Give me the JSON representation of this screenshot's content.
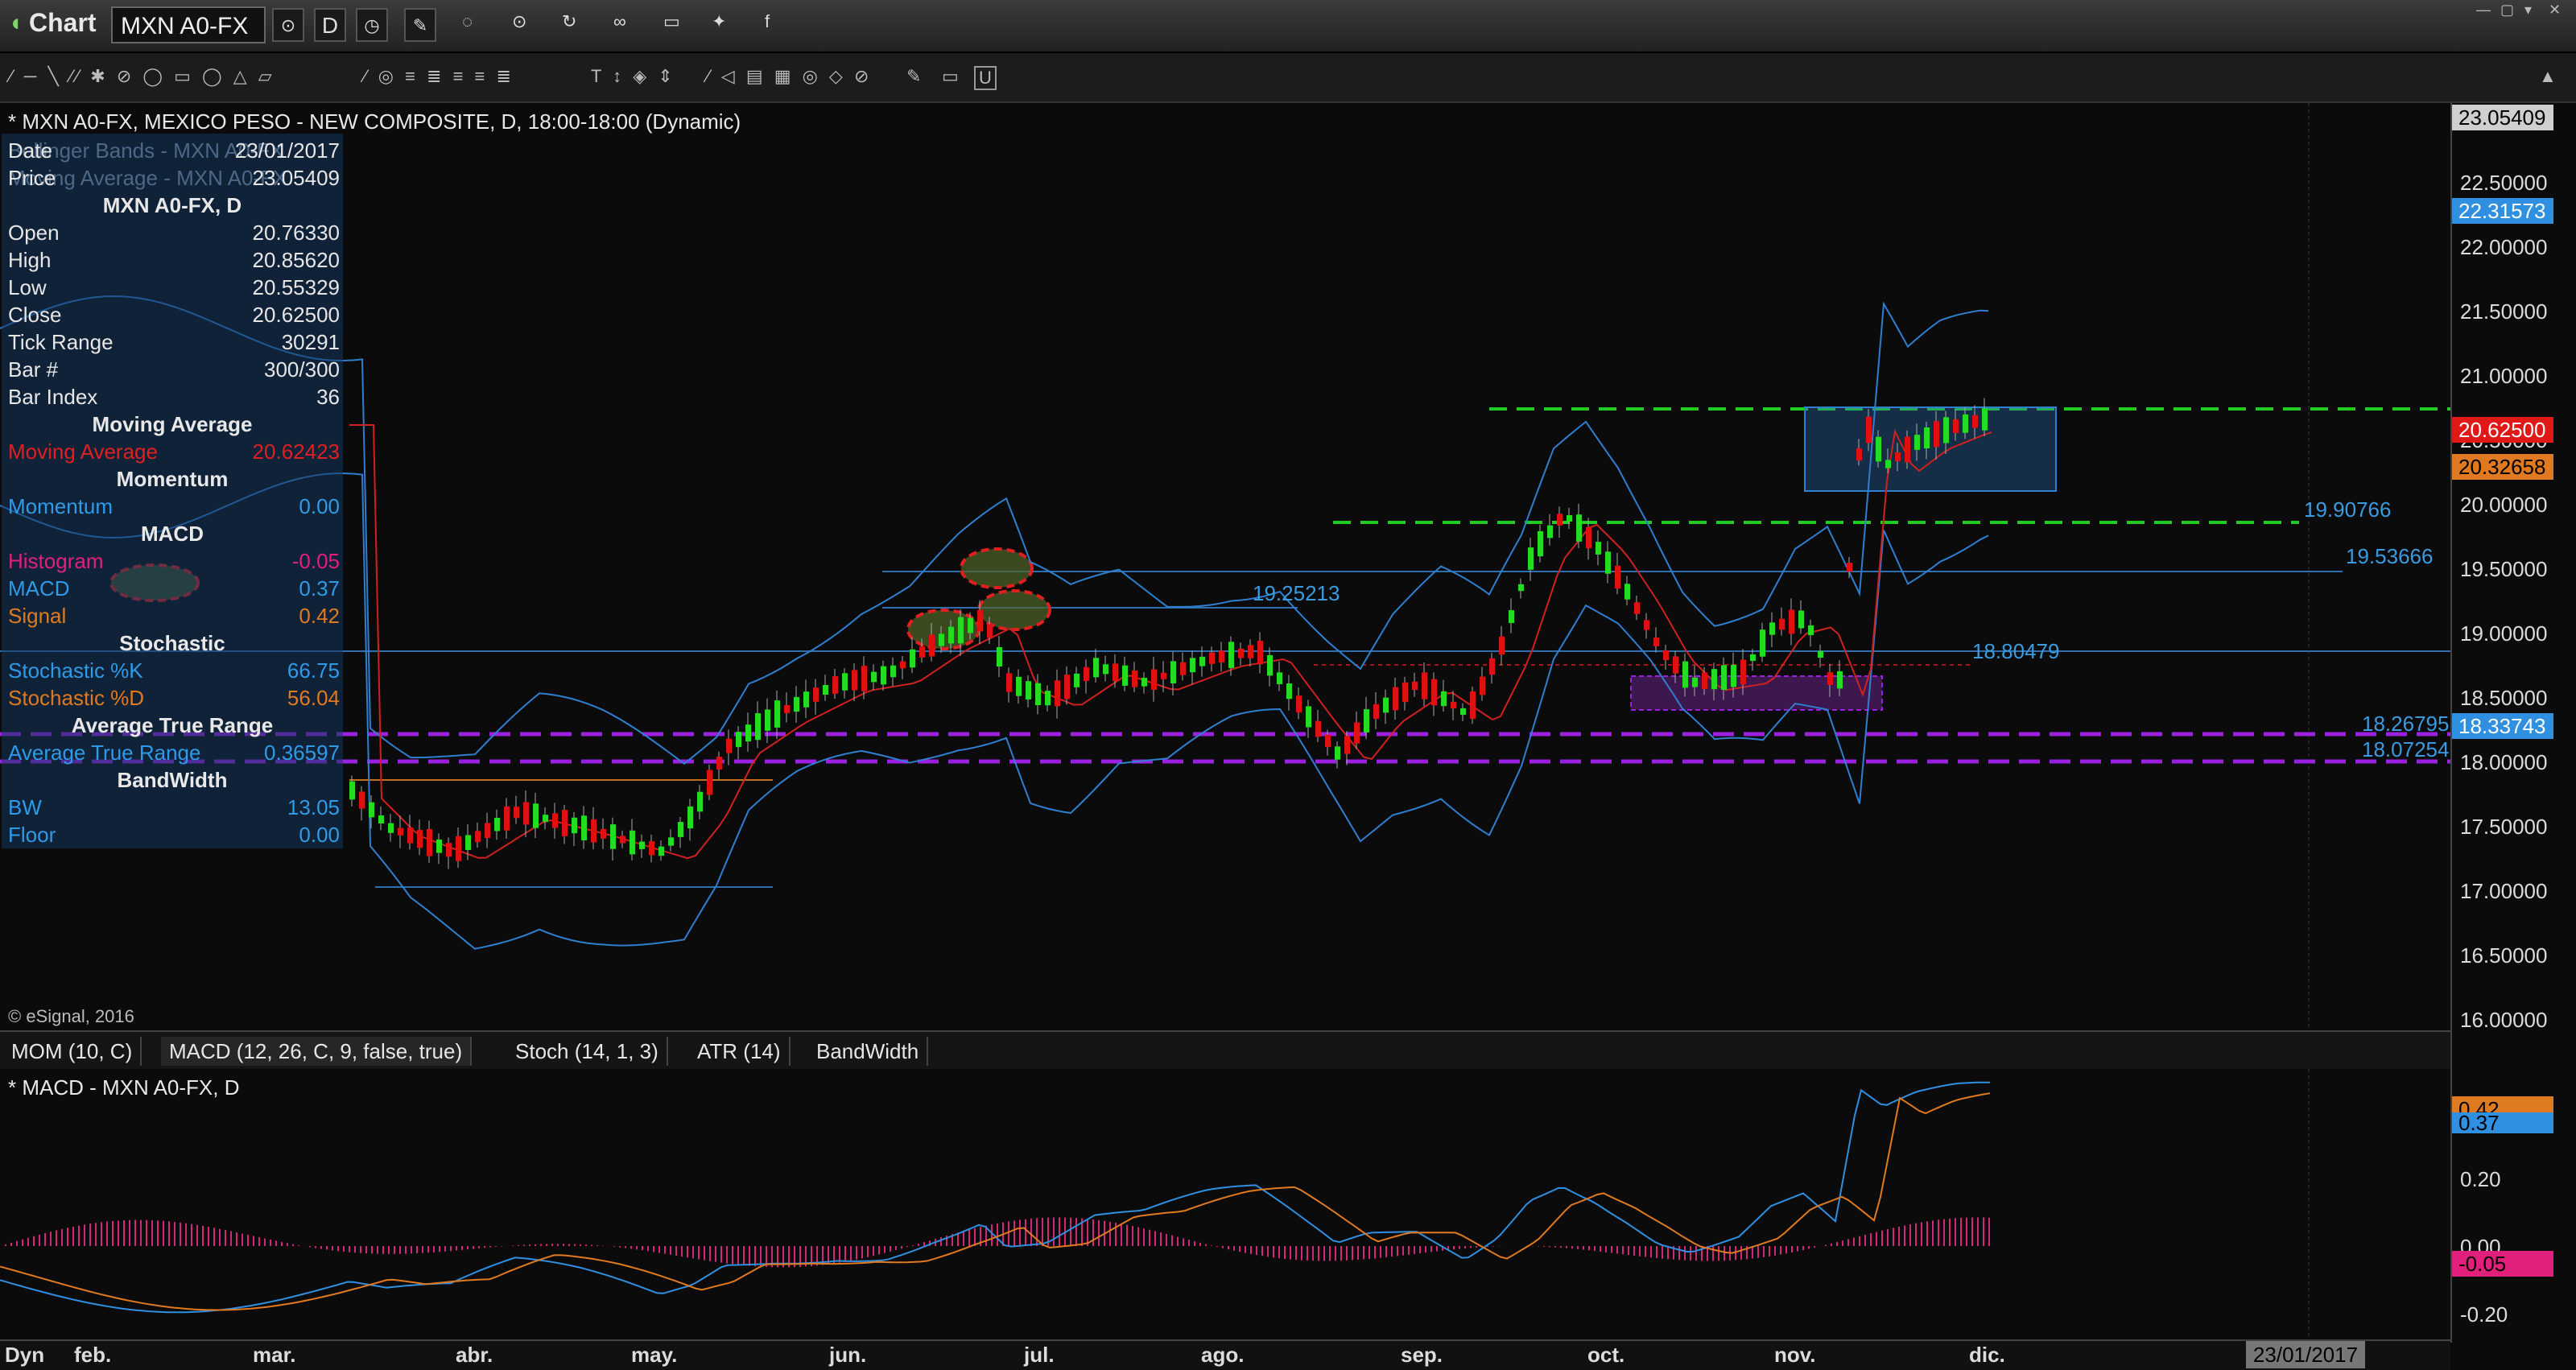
{
  "window": {
    "app_title": "Chart",
    "symbol": "MXN A0-FX",
    "interval": "D"
  },
  "chart": {
    "header": "* MXN A0-FX, MEXICO PESO - NEW COMPOSITE, D, 18:00-18:00 (Dynamic)",
    "overlay_line1": "Bollinger Bands - MXN A0-FX",
    "overlay_line2": "Moving Average - MXN A0-FX",
    "copyright": "© eSignal, 2016"
  },
  "data_window": {
    "date_label": "Date",
    "date_value": "23/01/2017",
    "price_label": "Price",
    "price_value": "23.05409",
    "symbol_head": "MXN A0-FX, D",
    "rows": [
      {
        "label": "Open",
        "value": "20.76330"
      },
      {
        "label": "High",
        "value": "20.85620"
      },
      {
        "label": "Low",
        "value": "20.55329"
      },
      {
        "label": "Close",
        "value": "20.62500"
      },
      {
        "label": "Tick Range",
        "value": "30291"
      },
      {
        "label": "Bar #",
        "value": "300/300"
      },
      {
        "label": "Bar Index",
        "value": "36"
      }
    ],
    "ma_head": "Moving Average",
    "ma_label": "Moving Average",
    "ma_value": "20.62423",
    "mom_head": "Momentum",
    "mom_label": "Momentum",
    "mom_value": "0.00",
    "macd_head": "MACD",
    "hist_label": "Histogram",
    "hist_value": "-0.05",
    "macd_label": "MACD",
    "macd_value": "0.37",
    "signal_label": "Signal",
    "signal_value": "0.42",
    "stoch_head": "Stochastic",
    "k_label": "Stochastic %K",
    "k_value": "66.75",
    "d_label": "Stochastic %D",
    "d_value": "56.04",
    "atr_head": "Average True Range",
    "atr_label": "Average True Range",
    "atr_value": "0.36597",
    "bw_head": "BandWidth",
    "bw_label": "BW",
    "bw_value": "13.05",
    "floor_label": "Floor",
    "floor_value": "0.00"
  },
  "price_axis": {
    "labels": [
      "22.50000",
      "22.00000",
      "21.50000",
      "21.00000",
      "20.50000",
      "20.00000",
      "19.50000",
      "19.00000",
      "18.50000",
      "18.00000",
      "17.50000",
      "17.00000",
      "16.50000",
      "16.00000"
    ],
    "tag_top": "23.05409",
    "tag_upper_band": "22.31573",
    "tag_close": "20.62500",
    "tag_ma": "20.32658",
    "tag_lower": "18.33743"
  },
  "levels": {
    "l1": "19.90766",
    "l2": "19.53666",
    "l3": "19.25213",
    "l4": "18.80479",
    "l5": "18.26795",
    "l6": "18.07254"
  },
  "indicator_tabs": [
    "MOM (10, C)",
    "MACD (12, 26, C, 9, false, true)",
    "Stoch (14, 1, 3)",
    "ATR (14)",
    "BandWidth"
  ],
  "macd_panel": {
    "header": "* MACD - MXN A0-FX, D",
    "axis_labels": [
      "0.20",
      "0.00",
      "-0.20"
    ],
    "tag_signal": "0.42",
    "tag_macd": "0.37",
    "tag_hist": "-0.05"
  },
  "time_axis": {
    "corner": "Dyn",
    "months": [
      "feb.",
      "mar.",
      "abr.",
      "may.",
      "jun.",
      "jul.",
      "ago.",
      "sep.",
      "oct.",
      "nov.",
      "dic."
    ],
    "cursor_date": "23/01/2017"
  },
  "colors": {
    "up_candle": "#22dd22",
    "down_candle": "#e01010",
    "band": "#2f7fd0",
    "ma": "#d02020",
    "green_level": "#22cc22",
    "purple_level": "#9b20e0",
    "macd_line": "#2f8fe0",
    "signal_line": "#e07a20",
    "histogram": "#d0287a"
  }
}
